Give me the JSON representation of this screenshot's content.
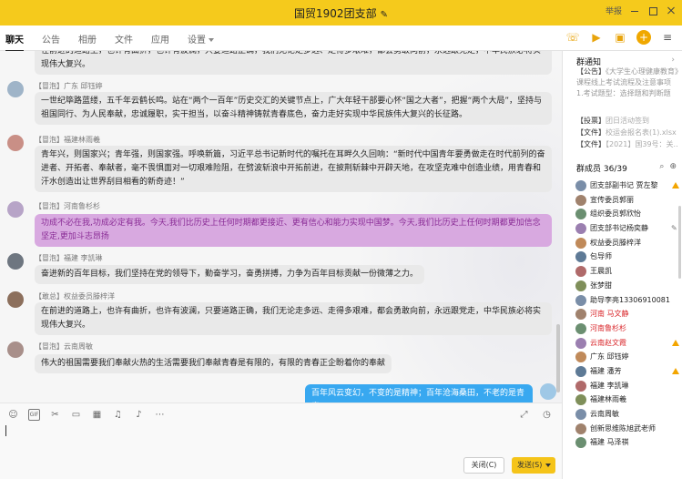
{
  "window": {
    "title": "国贸1902团支部",
    "report": "举报"
  },
  "tabs": [
    {
      "label": "聊天",
      "active": true
    },
    {
      "label": "公告"
    },
    {
      "label": "相册"
    },
    {
      "label": "文件"
    },
    {
      "label": "应用"
    },
    {
      "label": "设置"
    }
  ],
  "messages": [
    {
      "sender_tag": "",
      "sender_name": "",
      "text": "在前进的道路上，也许有曲折，也许有波澜，只要道路正确，我们无论走多远、走得多艰难，都会勇敢向前，永远跟党走，中华民族必将实现伟大复兴。"
    },
    {
      "sender_tag": "【冒泡】",
      "sender_name": "广东 邱钰婷",
      "text": "一世纪筚路蓝缕，五千年云鹤长鸣。站在“两个一百年”历史交汇的关键节点上，广大年轻干部要心怀“国之大者”，把握“两个大局”，坚持与祖国同行、为人民奉献，忠诚履职，实干担当，以奋斗精神铸就青春底色，奋力走好实现中华民族伟大复兴的长征路。"
    },
    {
      "sender_tag": "【冒泡】",
      "sender_name": "福建林雨羲",
      "text": "青年兴，则国家兴；青年强，则国家强。呼唤新篇，习近平总书记新时代的嘱托在耳畔久久回响：“新时代中国青年要勇做走在时代前列的奋进者、开拓者、奉献者，毫不畏惧面对一切艰难险阻，在劈波斩浪中开拓前进，在披荆斩棘中开辟天地，在攻坚克难中创造业绩，用青春和汗水创造出让世界刮目相看的新奇迹！”"
    },
    {
      "sender_tag": "【冒泡】",
      "sender_name": "河南鲁杉杉",
      "text": "功成不必在我,功成必定有我。今天,我们比历史上任何时期都更接近、更有信心和能力实现中国梦。今天,我们比历史上任何时期都更加信念坚定,更加斗志昂扬"
    },
    {
      "sender_tag": "【冒泡】",
      "sender_name": "福建 李凯琳",
      "text": "奋进新的百年目标，我们坚持在党的领导下，勤奋学习，奋勇拼搏，力争为百年目标贡献一份微薄之力。"
    },
    {
      "sender_tag": "【敢总】",
      "sender_name": "权益委员滕梓洋",
      "text": "在前进的道路上，也许有曲折，也许有波澜，只要道路正确，我们无论走多远、走得多艰难，都会勇敢向前，永远跟党走，中华民族必将实现伟大复兴。"
    },
    {
      "sender_tag": "【冒泡】",
      "sender_name": "云南周敏",
      "text": "伟大的祖国需要我们奉献火热的生活需要我们奉献青春是有限的，有限的青春正企盼着你的奉献"
    },
    {
      "sender_tag": "",
      "sender_name": "",
      "text": "百年风云变幻，不变的是精神；百年沧海桑田，不老的是青春。",
      "mine": true
    }
  ],
  "input": {
    "close_label": "关闭(C)",
    "send_label": "发送(S)"
  },
  "notice": {
    "title": "群通知",
    "prefix": "【公告】",
    "highlight": "《大学生心理健康教",
    "rest": "育》课程线上考试流程及注意事项",
    "more": "1.考试题型：选择题和判断题"
  },
  "files": [
    {
      "tag": "【投票】",
      "text": "团日活动签到"
    },
    {
      "tag": "【文件】",
      "text": "校运会报名表(1).xlsx"
    },
    {
      "tag": "【文件】",
      "text": "【2021】国39号：关..."
    }
  ],
  "members_head": "群成员 36/39",
  "members": [
    {
      "name": "团支部副书记 贾左黎",
      "color": "",
      "badge": "crown"
    },
    {
      "name": "宣传委员郭丽",
      "color": "",
      "badge": ""
    },
    {
      "name": "组织委员郭欣怡",
      "color": "",
      "badge": ""
    },
    {
      "name": "团支部书记杨奕静",
      "color": "",
      "badge": "edit"
    },
    {
      "name": "权益委员滕梓洋",
      "color": "",
      "badge": ""
    },
    {
      "name": "包导师",
      "color": "",
      "badge": ""
    },
    {
      "name": "王晨凯",
      "color": "",
      "badge": ""
    },
    {
      "name": "张梦甜",
      "color": "",
      "badge": ""
    },
    {
      "name": "助导李亮13306910081",
      "color": "",
      "badge": ""
    },
    {
      "name": "河南 马文静",
      "color": "red",
      "badge": ""
    },
    {
      "name": "河南鲁杉杉",
      "color": "red",
      "badge": ""
    },
    {
      "name": "云南赵文霞",
      "color": "red",
      "badge": "crown"
    },
    {
      "name": "广东 邱钰婷",
      "color": "",
      "badge": ""
    },
    {
      "name": "福建 潘芳",
      "color": "",
      "badge": "crown"
    },
    {
      "name": "福建 李凯琳",
      "color": "",
      "badge": ""
    },
    {
      "name": "福建林雨羲",
      "color": "",
      "badge": ""
    },
    {
      "name": "云南周敏",
      "color": "",
      "badge": ""
    },
    {
      "name": "创新思维陈旭武老师",
      "color": "",
      "badge": ""
    },
    {
      "name": "福建 马泽祺",
      "color": "",
      "badge": ""
    }
  ]
}
